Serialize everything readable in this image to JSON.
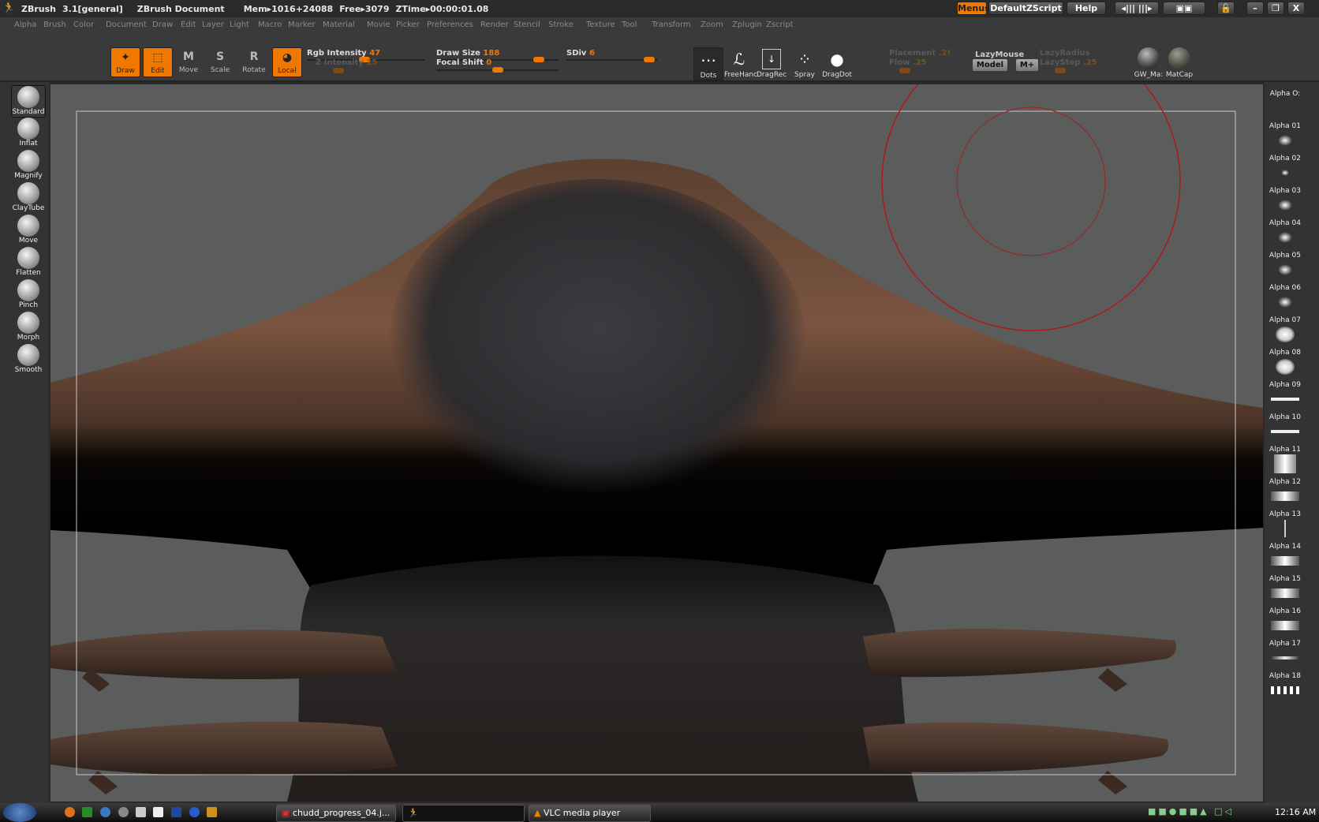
{
  "titlebar": {
    "app": "ZBrush",
    "version": "3.1[general]",
    "document": "ZBrush Document",
    "mem": "Mem▸1016+24088",
    "free": "Free▸3079",
    "ztime": "ZTime▸00:00:01.08",
    "menus_btn": "Menus",
    "script_btn": "DefaultZScript",
    "help_btn": "Help",
    "accent": "#f07800"
  },
  "menu": [
    "Alpha",
    "Brush",
    "Color",
    "Document",
    "Draw",
    "Edit",
    "Layer",
    "Light",
    "Macro",
    "Marker",
    "Material",
    "Movie",
    "Picker",
    "Preferences",
    "Render",
    "Stencil",
    "Stroke",
    "Texture",
    "Tool",
    "Transform",
    "Zoom",
    "Zplugin",
    "Zscript"
  ],
  "tools": [
    {
      "label": "Draw",
      "icon": "draw-icon",
      "active": true
    },
    {
      "label": "Edit",
      "icon": "edit-icon",
      "active": true
    },
    {
      "label": "Move",
      "icon": "M",
      "active": false
    },
    {
      "label": "Scale",
      "icon": "S",
      "active": false
    },
    {
      "label": "Rotate",
      "icon": "R",
      "active": false
    },
    {
      "label": "Local",
      "icon": "local-icon",
      "active": true
    }
  ],
  "sliders": {
    "rgb_label": "Rgb Intensity",
    "rgb": "47",
    "z_label": "Z Intensity",
    "z": "25",
    "drawsize_label": "Draw Size",
    "drawsize": "188",
    "focal_label": "Focal Shift",
    "focal": "0",
    "sdiv_label": "SDiv",
    "sdiv": "6",
    "placement_label": "Placement",
    "placement": ".2!",
    "flow_label": "Flow",
    "flow": ".25",
    "lazymouse_label": "LazyMouse",
    "model_btn": "Model",
    "mplus_btn": "M+",
    "lazyradius_label": "LazyRadius",
    "lazystep_label": "LazyStep",
    "lazystep": ".25"
  },
  "strokes": [
    {
      "label": "Dots",
      "glyph": "⋯"
    },
    {
      "label": "FreeHanc",
      "glyph": "ℒ"
    },
    {
      "label": "DragRec",
      "glyph": "↓"
    },
    {
      "label": "Spray",
      "glyph": "⁘"
    },
    {
      "label": "DragDot",
      "glyph": "●"
    }
  ],
  "materials": [
    {
      "label": "GW_Ma:"
    },
    {
      "label": "MatCap"
    }
  ],
  "brushes": [
    "Standard",
    "Inflat",
    "Magnify",
    "ClayTube",
    "Move",
    "Flatten",
    "Pinch",
    "Morph",
    "Smooth"
  ],
  "alphas": [
    "Alpha O:",
    "Alpha 01",
    "Alpha 02",
    "Alpha 03",
    "Alpha 04",
    "Alpha 05",
    "Alpha 06",
    "Alpha 07",
    "Alpha 08",
    "Alpha 09",
    "Alpha 10",
    "Alpha 11",
    "Alpha 12",
    "Alpha 13",
    "Alpha 14",
    "Alpha 15",
    "Alpha 16",
    "Alpha 17",
    "Alpha 18"
  ],
  "taskbar": {
    "tasks": [
      "chudd_progress_04.j...",
      "",
      "VLC media player"
    ],
    "clock": "12:16 AM"
  }
}
